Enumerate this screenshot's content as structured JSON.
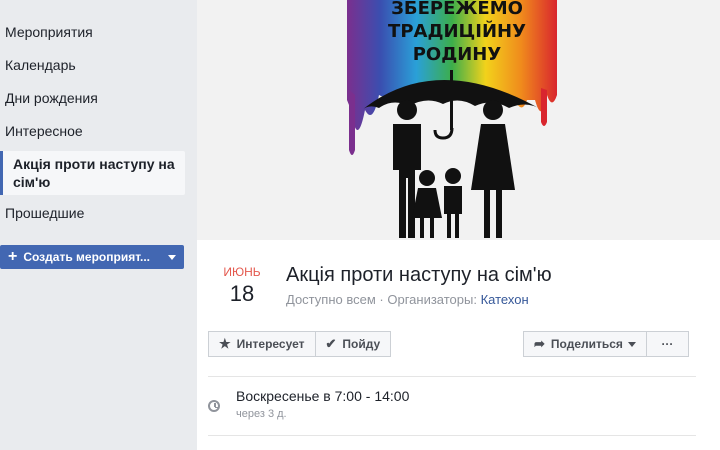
{
  "sidebar": {
    "items": [
      {
        "label": "Мероприятия"
      },
      {
        "label": "Календарь"
      },
      {
        "label": "Дни рождения"
      },
      {
        "label": "Интересное"
      },
      {
        "label": "Акція проти наступу на сім'ю"
      },
      {
        "label": "Прошедшие"
      }
    ],
    "create_button": "Создать мероприят..."
  },
  "cover": {
    "text_line1": "ЗБЕРЕЖЕМО",
    "text_line2": "ТРАДИЦІЙНУ",
    "text_line3": "РОДИНУ"
  },
  "event": {
    "month": "ИЮНЬ",
    "day": "18",
    "title": "Акція проти наступу на сім'ю",
    "visibility": "Доступно всем",
    "organizers_label": "Организаторы:",
    "organizer": "Катехон"
  },
  "actions": {
    "interested": "Интересует",
    "going": "Пойду",
    "share": "Поделиться",
    "more": "···"
  },
  "time": {
    "main": "Воскресенье в 7:00 - 14:00",
    "relative": "через 3 д."
  },
  "colors": {
    "accent": "#4267b2",
    "month": "#e4584d",
    "link": "#365899"
  }
}
